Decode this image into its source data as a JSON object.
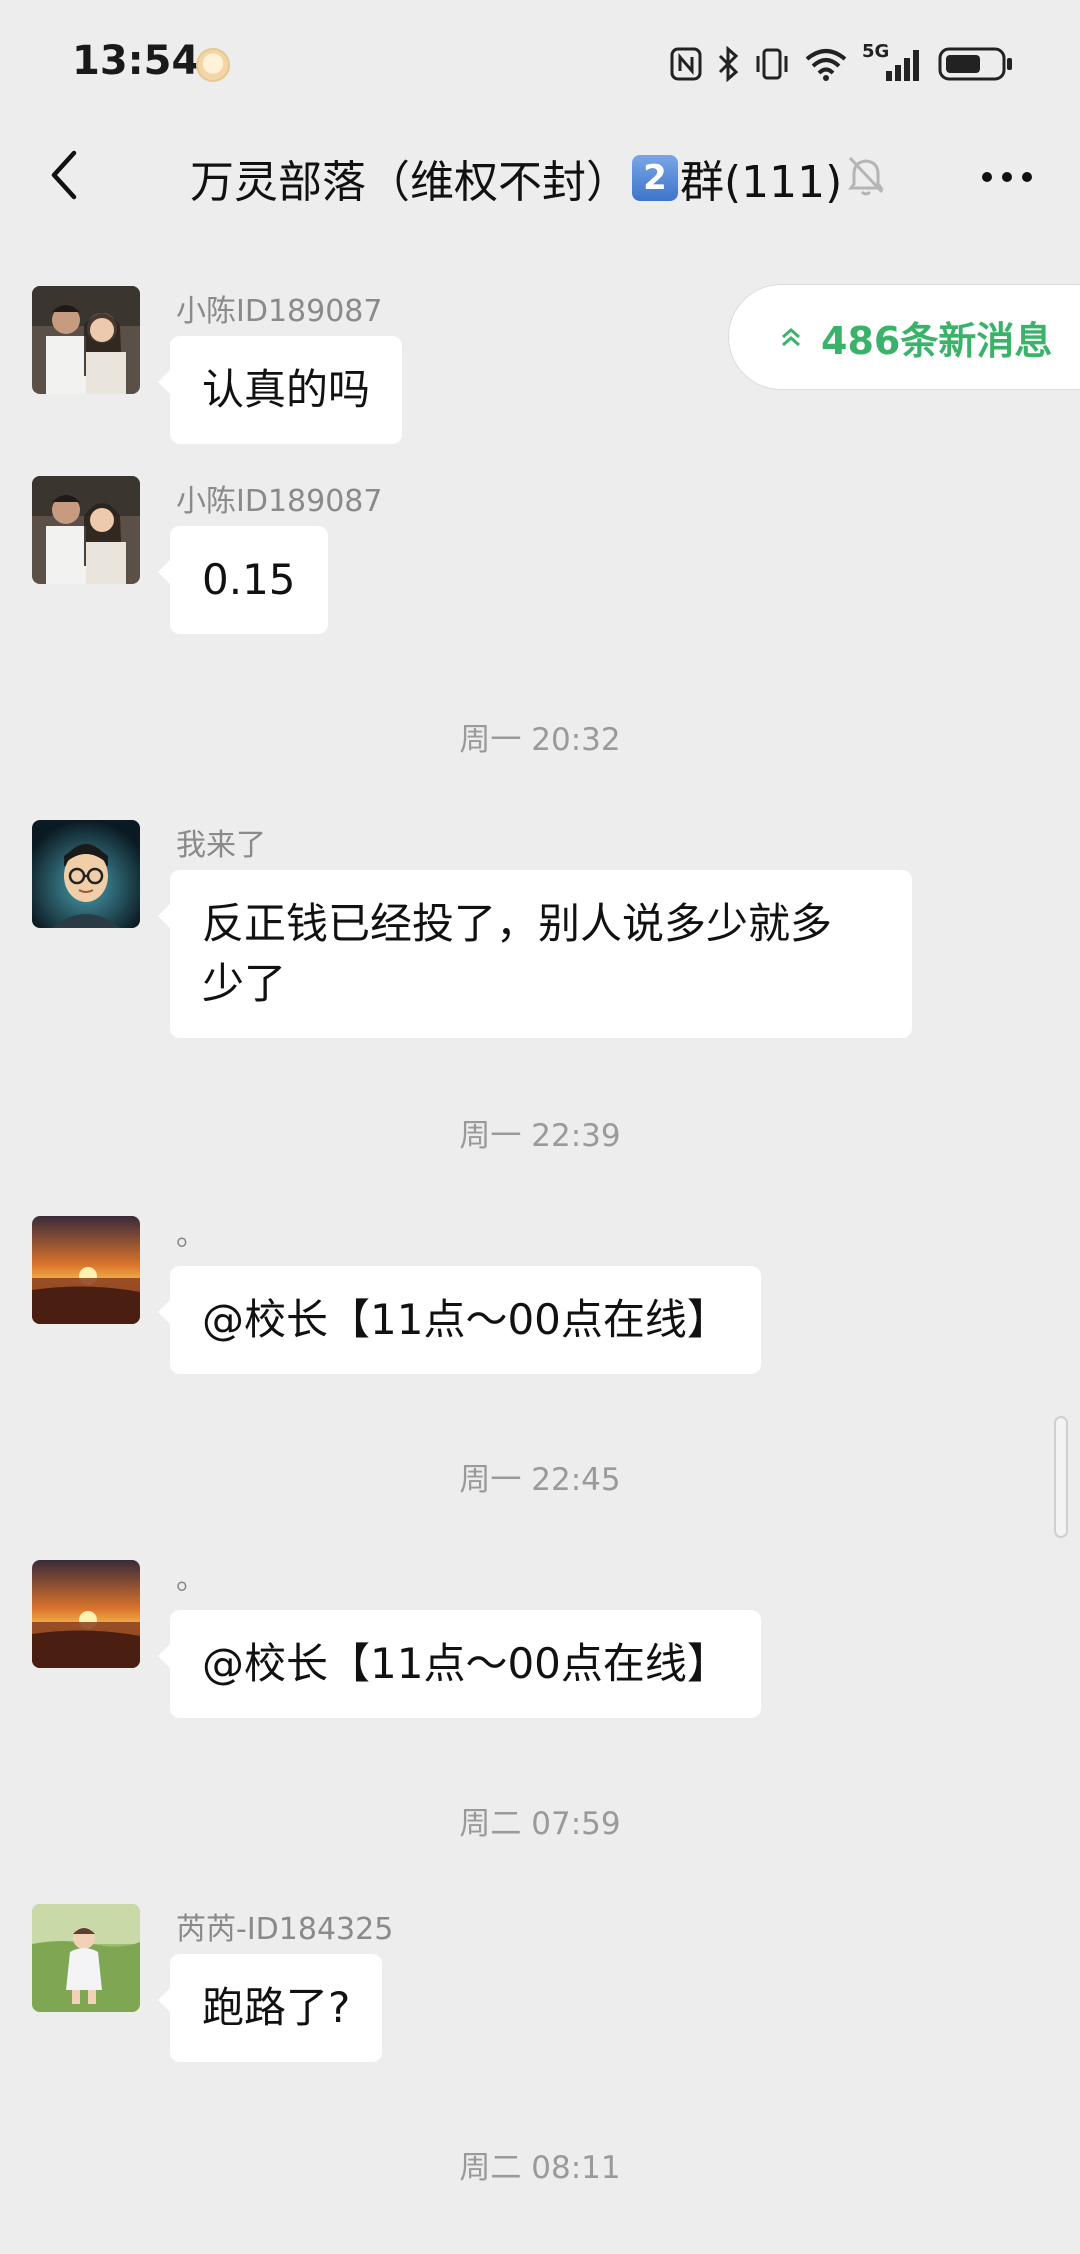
{
  "status_bar": {
    "time": "13:54",
    "network": "5G"
  },
  "header": {
    "title_prefix": "万灵部落（维权不封）",
    "title_keycap": "2",
    "title_suffix": "群(111)"
  },
  "new_messages": {
    "label": "486条新消息"
  },
  "messages": [
    {
      "sender": "小陈ID189087",
      "text": "认真的吗",
      "avatar": "couple-photo"
    },
    {
      "sender": "小陈ID189087",
      "text": "0.15",
      "avatar": "couple-photo"
    },
    {
      "timestamp": "周一 20:32"
    },
    {
      "sender": "我来了",
      "text_line1": "反正钱已经投了，别人说多少就多",
      "text_line2": "少了",
      "avatar": "cartoon-man"
    },
    {
      "timestamp": "周一 22:39"
    },
    {
      "sender": "。",
      "text": "@校长【11点～00点在线】",
      "avatar": "sunset"
    },
    {
      "timestamp": "周一 22:45"
    },
    {
      "sender": "。",
      "text": "@校长【11点～00点在线】",
      "avatar": "sunset"
    },
    {
      "timestamp": "周二 07:59"
    },
    {
      "sender": "芮芮-ID184325",
      "text": "跑路了?",
      "avatar": "child-on-grass"
    },
    {
      "timestamp": "周二 08:11"
    }
  ],
  "colors": {
    "background": "#ededed",
    "bubble": "#ffffff",
    "accent_green": "#3bb26a"
  },
  "icons": [
    "back-arrow-icon",
    "mute-bell-icon",
    "more-dots-icon",
    "double-chevron-up-icon",
    "nfc-icon",
    "bluetooth-icon",
    "vibrate-icon",
    "wifi-icon",
    "signal-icon",
    "battery-icon"
  ]
}
